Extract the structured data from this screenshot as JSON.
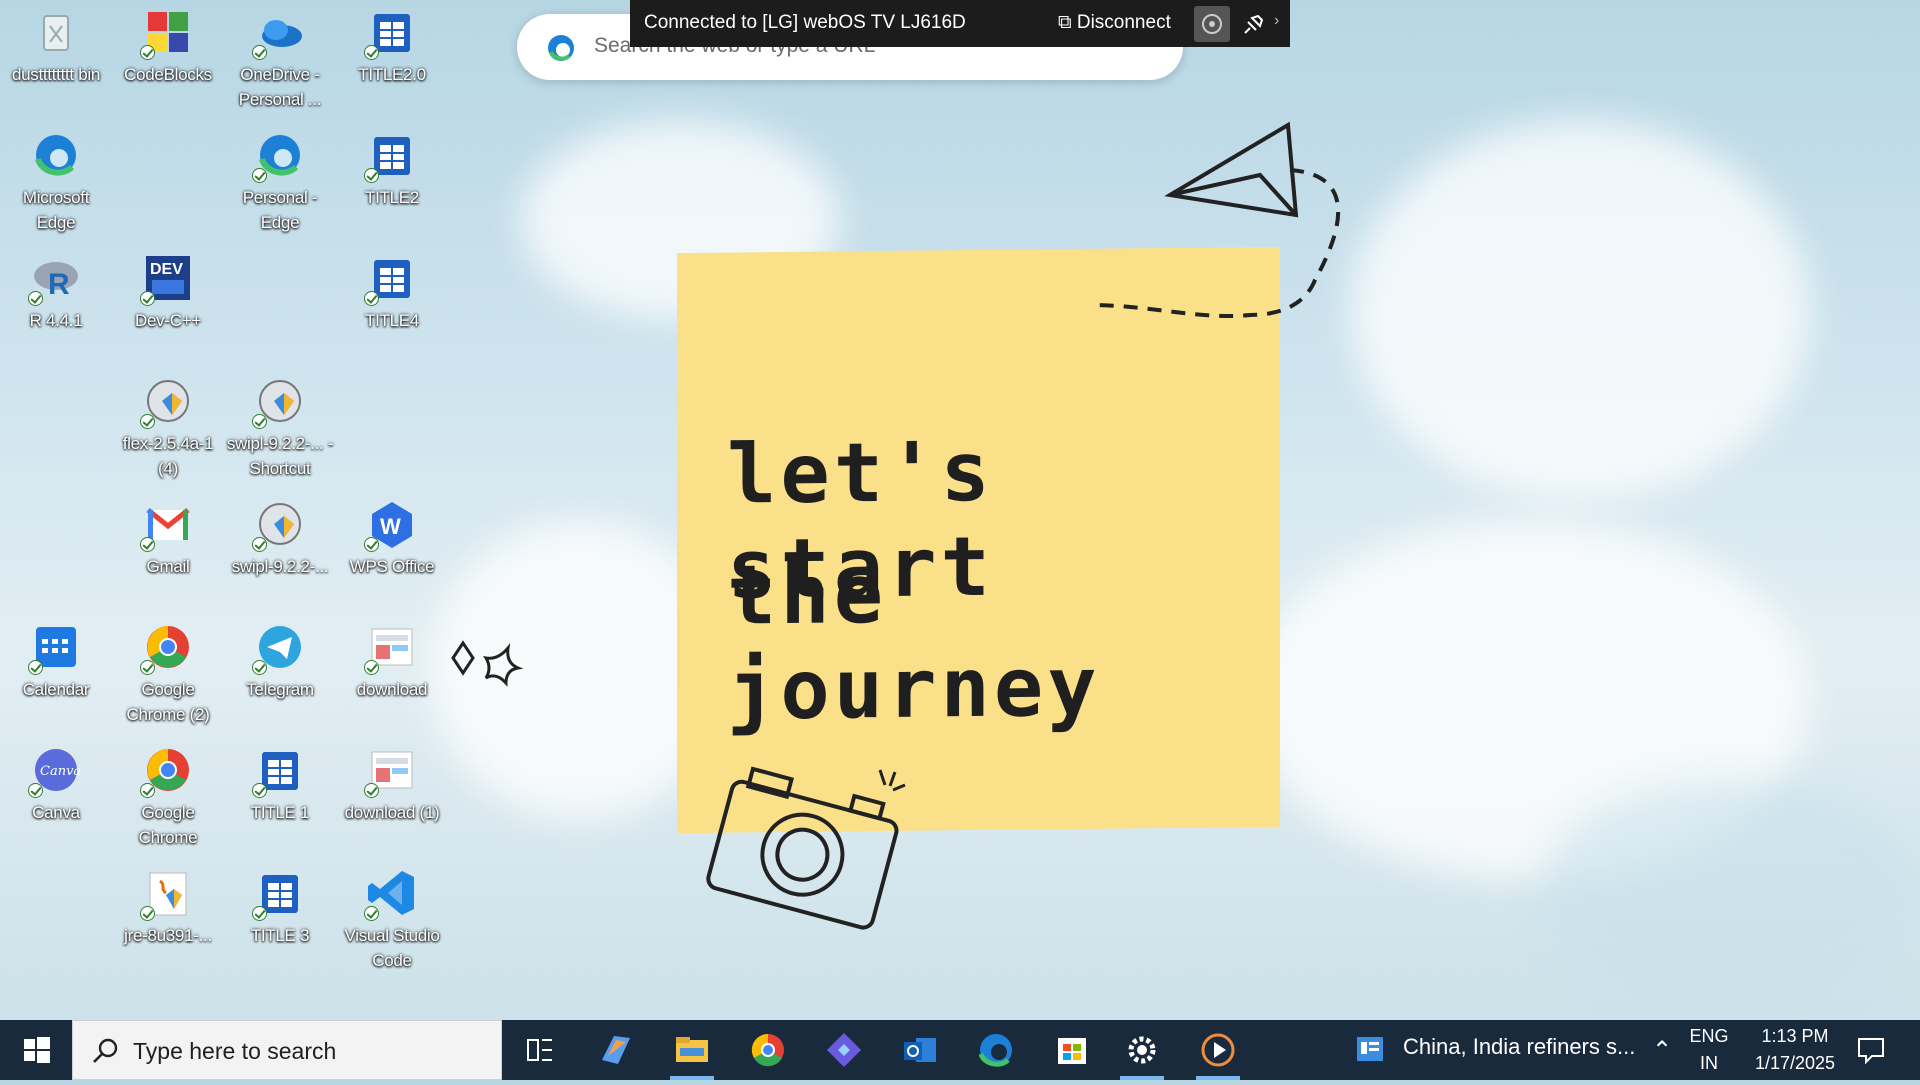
{
  "desktop_icons": [
    {
      "label": "dustttttttt bin",
      "icon": "recycle-bin-icon"
    },
    {
      "label": "CodeBlocks",
      "icon": "codeblocks-icon"
    },
    {
      "label": "OneDrive - Personal ...",
      "icon": "onedrive-icon"
    },
    {
      "label": "TITLE2.0",
      "icon": "document-icon"
    },
    {
      "label": "Microsoft Edge",
      "icon": "edge-icon"
    },
    {
      "label": "Personal - Edge",
      "icon": "edge-icon"
    },
    {
      "label": "TITLE2",
      "icon": "document-icon"
    },
    {
      "label": "R 4.4.1",
      "icon": "r-icon"
    },
    {
      "label": "Dev-C++",
      "icon": "devcpp-icon"
    },
    {
      "label": "TITLE4",
      "icon": "document-icon"
    },
    {
      "label": "flex-2.5.4a-1 (4)",
      "icon": "installer-icon"
    },
    {
      "label": "swipl-9.2.2-... - Shortcut",
      "icon": "installer-icon"
    },
    {
      "label": "Gmail",
      "icon": "gmail-icon"
    },
    {
      "label": "swipl-9.2.2-...",
      "icon": "installer-icon"
    },
    {
      "label": "WPS Office",
      "icon": "wps-icon"
    },
    {
      "label": "Calendar",
      "icon": "calendar-icon"
    },
    {
      "label": "Google Chrome (2)",
      "icon": "chrome-icon"
    },
    {
      "label": "Telegram",
      "icon": "telegram-icon"
    },
    {
      "label": "download",
      "icon": "image-file-icon"
    },
    {
      "label": "Canva",
      "icon": "canva-icon"
    },
    {
      "label": "Google Chrome",
      "icon": "chrome-icon"
    },
    {
      "label": "TITLE 1",
      "icon": "document-icon"
    },
    {
      "label": "download (1)",
      "icon": "image-file-icon"
    },
    {
      "label": "jre-8u391-...",
      "icon": "java-installer-icon"
    },
    {
      "label": "TITLE 3",
      "icon": "document-icon"
    },
    {
      "label": "Visual Studio Code",
      "icon": "vscode-icon"
    }
  ],
  "search_widget": {
    "placeholder": "Search the web or type a URL"
  },
  "cast_banner": {
    "status": "Connected to [LG] webOS TV LJ616D",
    "disconnect": "Disconnect"
  },
  "wallpaper": {
    "line1": "let's start",
    "line2": "the journey"
  },
  "taskbar": {
    "search_placeholder": "Type here to search",
    "news": "China, India refiners s...",
    "lang1": "ENG",
    "lang2": "IN",
    "time": "1:13 PM",
    "date": "1/17/2025"
  }
}
